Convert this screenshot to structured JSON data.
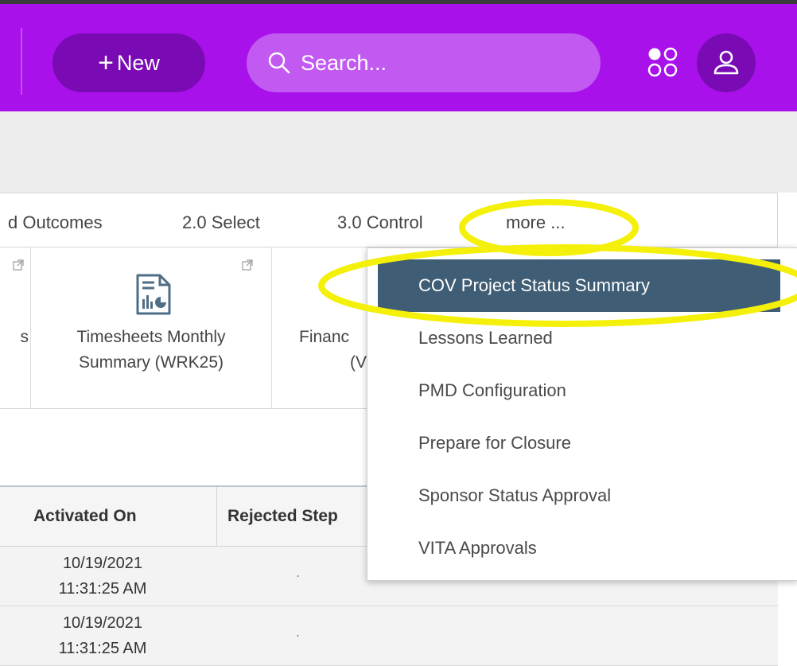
{
  "header": {
    "new_label": "New",
    "search_placeholder": "Search...",
    "apps_icon": "apps-grid-icon",
    "user_icon": "user-icon"
  },
  "tabs": {
    "items": [
      {
        "label": "d Outcomes"
      },
      {
        "label": "2.0 Select"
      },
      {
        "label": "3.0 Control"
      },
      {
        "label": "more ..."
      }
    ]
  },
  "tiles": {
    "partial_left": "s",
    "timesheets": {
      "line1": "Timesheets Monthly",
      "line2": "Summary (WRK25)"
    },
    "financial": {
      "line1": "Financ",
      "line2": "(V"
    }
  },
  "table": {
    "headers": [
      "Activated On",
      "Rejected Step"
    ],
    "rows": [
      {
        "date": "10/19/2021",
        "time": "11:31:25 AM",
        "rejected": "."
      },
      {
        "date": "10/19/2021",
        "time": "11:31:25 AM",
        "rejected": "."
      }
    ]
  },
  "menu": {
    "items": [
      {
        "label": "COV Project Status Summary",
        "active": true
      },
      {
        "label": "Lessons Learned"
      },
      {
        "label": "PMD Configuration"
      },
      {
        "label": "Prepare for Closure"
      },
      {
        "label": "Sponsor Status Approval"
      },
      {
        "label": "VITA Approvals"
      }
    ]
  },
  "colors": {
    "brand": "#a811ea",
    "menu_active": "#3f5d74",
    "highlight": "#f4f00a"
  }
}
